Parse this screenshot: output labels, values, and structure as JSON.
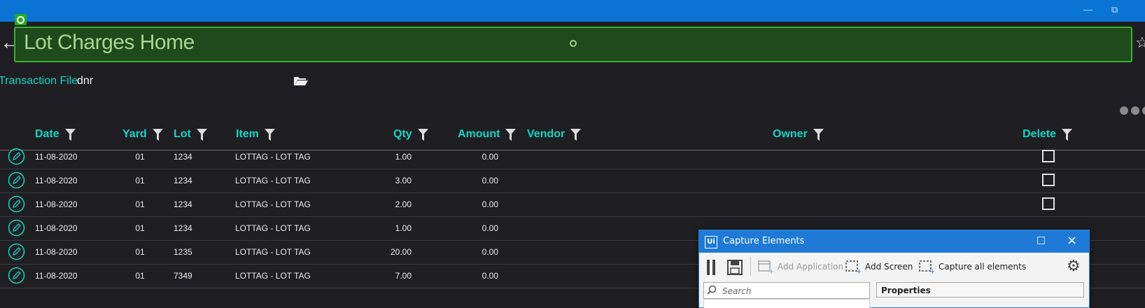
{
  "window": {
    "minimize_icon": "minimize-icon",
    "restore_icon": "restore-icon",
    "accent": "#0a74d4"
  },
  "page": {
    "title": "Lot Charges Home",
    "transaction_file_label": "Transaction File",
    "transaction_file_value": "dnr"
  },
  "grid": {
    "columns": [
      "Date",
      "Yard",
      "Lot",
      "Item",
      "Qty",
      "Amount",
      "Vendor",
      "Owner",
      "Delete"
    ],
    "rows": [
      {
        "date": "11-08-2020",
        "yard": "01",
        "lot": "1234",
        "item": "LOTTAG - LOT TAG",
        "qty": "1.00",
        "amount": "0.00",
        "vendor": "",
        "owner": "",
        "delete": false
      },
      {
        "date": "11-08-2020",
        "yard": "01",
        "lot": "1234",
        "item": "LOTTAG - LOT TAG",
        "qty": "3.00",
        "amount": "0.00",
        "vendor": "",
        "owner": "",
        "delete": false
      },
      {
        "date": "11-08-2020",
        "yard": "01",
        "lot": "1234",
        "item": "LOTTAG - LOT TAG",
        "qty": "2.00",
        "amount": "0.00",
        "vendor": "",
        "owner": "",
        "delete": false
      },
      {
        "date": "11-08-2020",
        "yard": "01",
        "lot": "1234",
        "item": "LOTTAG - LOT TAG",
        "qty": "1.00",
        "amount": "0.00",
        "vendor": "",
        "owner": "",
        "delete": null
      },
      {
        "date": "11-08-2020",
        "yard": "01",
        "lot": "1235",
        "item": "LOTTAG - LOT TAG",
        "qty": "20.00",
        "amount": "0.00",
        "vendor": "",
        "owner": "",
        "delete": null
      },
      {
        "date": "11-08-2020",
        "yard": "01",
        "lot": "7349",
        "item": "LOTTAG - LOT TAG",
        "qty": "7.00",
        "amount": "0.00",
        "vendor": "",
        "owner": "",
        "delete": null
      }
    ],
    "header_color": "#19d3c5"
  },
  "capture_window": {
    "logo": "Ui",
    "title": "Capture Elements",
    "toolbar": {
      "add_application": "Add Application",
      "add_screen": "Add Screen",
      "capture_all": "Capture all elements"
    },
    "search_placeholder": "Search",
    "properties_label": "Properties",
    "accent": "#1e7ad6"
  }
}
